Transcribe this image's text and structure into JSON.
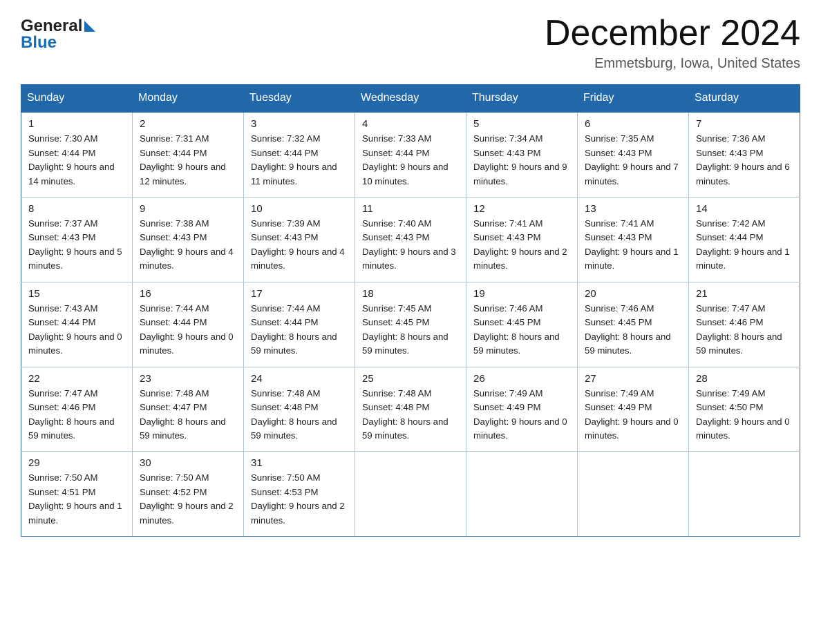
{
  "header": {
    "logo_general": "General",
    "logo_blue": "Blue",
    "month_title": "December 2024",
    "location": "Emmetsburg, Iowa, United States"
  },
  "days_of_week": [
    "Sunday",
    "Monday",
    "Tuesday",
    "Wednesday",
    "Thursday",
    "Friday",
    "Saturday"
  ],
  "weeks": [
    [
      {
        "day": "1",
        "sunrise": "Sunrise: 7:30 AM",
        "sunset": "Sunset: 4:44 PM",
        "daylight": "Daylight: 9 hours and 14 minutes."
      },
      {
        "day": "2",
        "sunrise": "Sunrise: 7:31 AM",
        "sunset": "Sunset: 4:44 PM",
        "daylight": "Daylight: 9 hours and 12 minutes."
      },
      {
        "day": "3",
        "sunrise": "Sunrise: 7:32 AM",
        "sunset": "Sunset: 4:44 PM",
        "daylight": "Daylight: 9 hours and 11 minutes."
      },
      {
        "day": "4",
        "sunrise": "Sunrise: 7:33 AM",
        "sunset": "Sunset: 4:44 PM",
        "daylight": "Daylight: 9 hours and 10 minutes."
      },
      {
        "day": "5",
        "sunrise": "Sunrise: 7:34 AM",
        "sunset": "Sunset: 4:43 PM",
        "daylight": "Daylight: 9 hours and 9 minutes."
      },
      {
        "day": "6",
        "sunrise": "Sunrise: 7:35 AM",
        "sunset": "Sunset: 4:43 PM",
        "daylight": "Daylight: 9 hours and 7 minutes."
      },
      {
        "day": "7",
        "sunrise": "Sunrise: 7:36 AM",
        "sunset": "Sunset: 4:43 PM",
        "daylight": "Daylight: 9 hours and 6 minutes."
      }
    ],
    [
      {
        "day": "8",
        "sunrise": "Sunrise: 7:37 AM",
        "sunset": "Sunset: 4:43 PM",
        "daylight": "Daylight: 9 hours and 5 minutes."
      },
      {
        "day": "9",
        "sunrise": "Sunrise: 7:38 AM",
        "sunset": "Sunset: 4:43 PM",
        "daylight": "Daylight: 9 hours and 4 minutes."
      },
      {
        "day": "10",
        "sunrise": "Sunrise: 7:39 AM",
        "sunset": "Sunset: 4:43 PM",
        "daylight": "Daylight: 9 hours and 4 minutes."
      },
      {
        "day": "11",
        "sunrise": "Sunrise: 7:40 AM",
        "sunset": "Sunset: 4:43 PM",
        "daylight": "Daylight: 9 hours and 3 minutes."
      },
      {
        "day": "12",
        "sunrise": "Sunrise: 7:41 AM",
        "sunset": "Sunset: 4:43 PM",
        "daylight": "Daylight: 9 hours and 2 minutes."
      },
      {
        "day": "13",
        "sunrise": "Sunrise: 7:41 AM",
        "sunset": "Sunset: 4:43 PM",
        "daylight": "Daylight: 9 hours and 1 minute."
      },
      {
        "day": "14",
        "sunrise": "Sunrise: 7:42 AM",
        "sunset": "Sunset: 4:44 PM",
        "daylight": "Daylight: 9 hours and 1 minute."
      }
    ],
    [
      {
        "day": "15",
        "sunrise": "Sunrise: 7:43 AM",
        "sunset": "Sunset: 4:44 PM",
        "daylight": "Daylight: 9 hours and 0 minutes."
      },
      {
        "day": "16",
        "sunrise": "Sunrise: 7:44 AM",
        "sunset": "Sunset: 4:44 PM",
        "daylight": "Daylight: 9 hours and 0 minutes."
      },
      {
        "day": "17",
        "sunrise": "Sunrise: 7:44 AM",
        "sunset": "Sunset: 4:44 PM",
        "daylight": "Daylight: 8 hours and 59 minutes."
      },
      {
        "day": "18",
        "sunrise": "Sunrise: 7:45 AM",
        "sunset": "Sunset: 4:45 PM",
        "daylight": "Daylight: 8 hours and 59 minutes."
      },
      {
        "day": "19",
        "sunrise": "Sunrise: 7:46 AM",
        "sunset": "Sunset: 4:45 PM",
        "daylight": "Daylight: 8 hours and 59 minutes."
      },
      {
        "day": "20",
        "sunrise": "Sunrise: 7:46 AM",
        "sunset": "Sunset: 4:45 PM",
        "daylight": "Daylight: 8 hours and 59 minutes."
      },
      {
        "day": "21",
        "sunrise": "Sunrise: 7:47 AM",
        "sunset": "Sunset: 4:46 PM",
        "daylight": "Daylight: 8 hours and 59 minutes."
      }
    ],
    [
      {
        "day": "22",
        "sunrise": "Sunrise: 7:47 AM",
        "sunset": "Sunset: 4:46 PM",
        "daylight": "Daylight: 8 hours and 59 minutes."
      },
      {
        "day": "23",
        "sunrise": "Sunrise: 7:48 AM",
        "sunset": "Sunset: 4:47 PM",
        "daylight": "Daylight: 8 hours and 59 minutes."
      },
      {
        "day": "24",
        "sunrise": "Sunrise: 7:48 AM",
        "sunset": "Sunset: 4:48 PM",
        "daylight": "Daylight: 8 hours and 59 minutes."
      },
      {
        "day": "25",
        "sunrise": "Sunrise: 7:48 AM",
        "sunset": "Sunset: 4:48 PM",
        "daylight": "Daylight: 8 hours and 59 minutes."
      },
      {
        "day": "26",
        "sunrise": "Sunrise: 7:49 AM",
        "sunset": "Sunset: 4:49 PM",
        "daylight": "Daylight: 9 hours and 0 minutes."
      },
      {
        "day": "27",
        "sunrise": "Sunrise: 7:49 AM",
        "sunset": "Sunset: 4:49 PM",
        "daylight": "Daylight: 9 hours and 0 minutes."
      },
      {
        "day": "28",
        "sunrise": "Sunrise: 7:49 AM",
        "sunset": "Sunset: 4:50 PM",
        "daylight": "Daylight: 9 hours and 0 minutes."
      }
    ],
    [
      {
        "day": "29",
        "sunrise": "Sunrise: 7:50 AM",
        "sunset": "Sunset: 4:51 PM",
        "daylight": "Daylight: 9 hours and 1 minute."
      },
      {
        "day": "30",
        "sunrise": "Sunrise: 7:50 AM",
        "sunset": "Sunset: 4:52 PM",
        "daylight": "Daylight: 9 hours and 2 minutes."
      },
      {
        "day": "31",
        "sunrise": "Sunrise: 7:50 AM",
        "sunset": "Sunset: 4:53 PM",
        "daylight": "Daylight: 9 hours and 2 minutes."
      },
      null,
      null,
      null,
      null
    ]
  ]
}
